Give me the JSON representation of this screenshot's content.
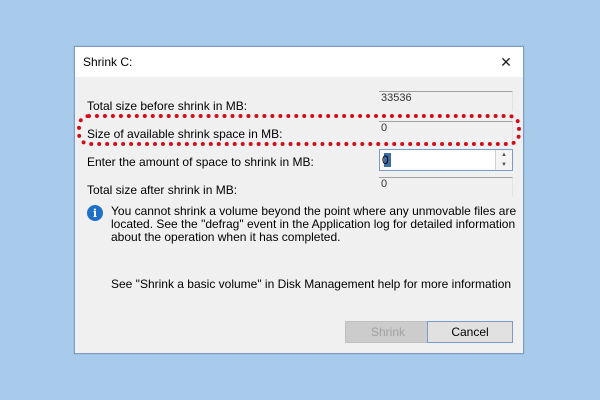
{
  "dialog": {
    "title": "Shrink C:",
    "close_glyph": "✕"
  },
  "rows": {
    "total_before": {
      "label": "Total size before shrink in MB:",
      "value": "33536"
    },
    "available": {
      "label": "Size of available shrink space in MB:",
      "value": "0"
    },
    "amount": {
      "label": "Enter the amount of space to shrink in MB:",
      "value": "0"
    },
    "total_after": {
      "label": "Total size after shrink in MB:",
      "value": "0"
    }
  },
  "info": {
    "text": "You cannot shrink a volume beyond the point where any unmovable files are located. See the \"defrag\" event in the Application log for detailed information about the operation when it has completed.",
    "icon": "info-icon"
  },
  "help": {
    "text": "See \"Shrink a basic volume\" in Disk Management help for more information"
  },
  "buttons": {
    "shrink": "Shrink",
    "cancel": "Cancel"
  },
  "spin": {
    "up_glyph": "▲",
    "down_glyph": "▼"
  },
  "colors": {
    "highlight": "#d10e17",
    "background": "#a8cbec",
    "info_icon": "#1f6fc5"
  }
}
